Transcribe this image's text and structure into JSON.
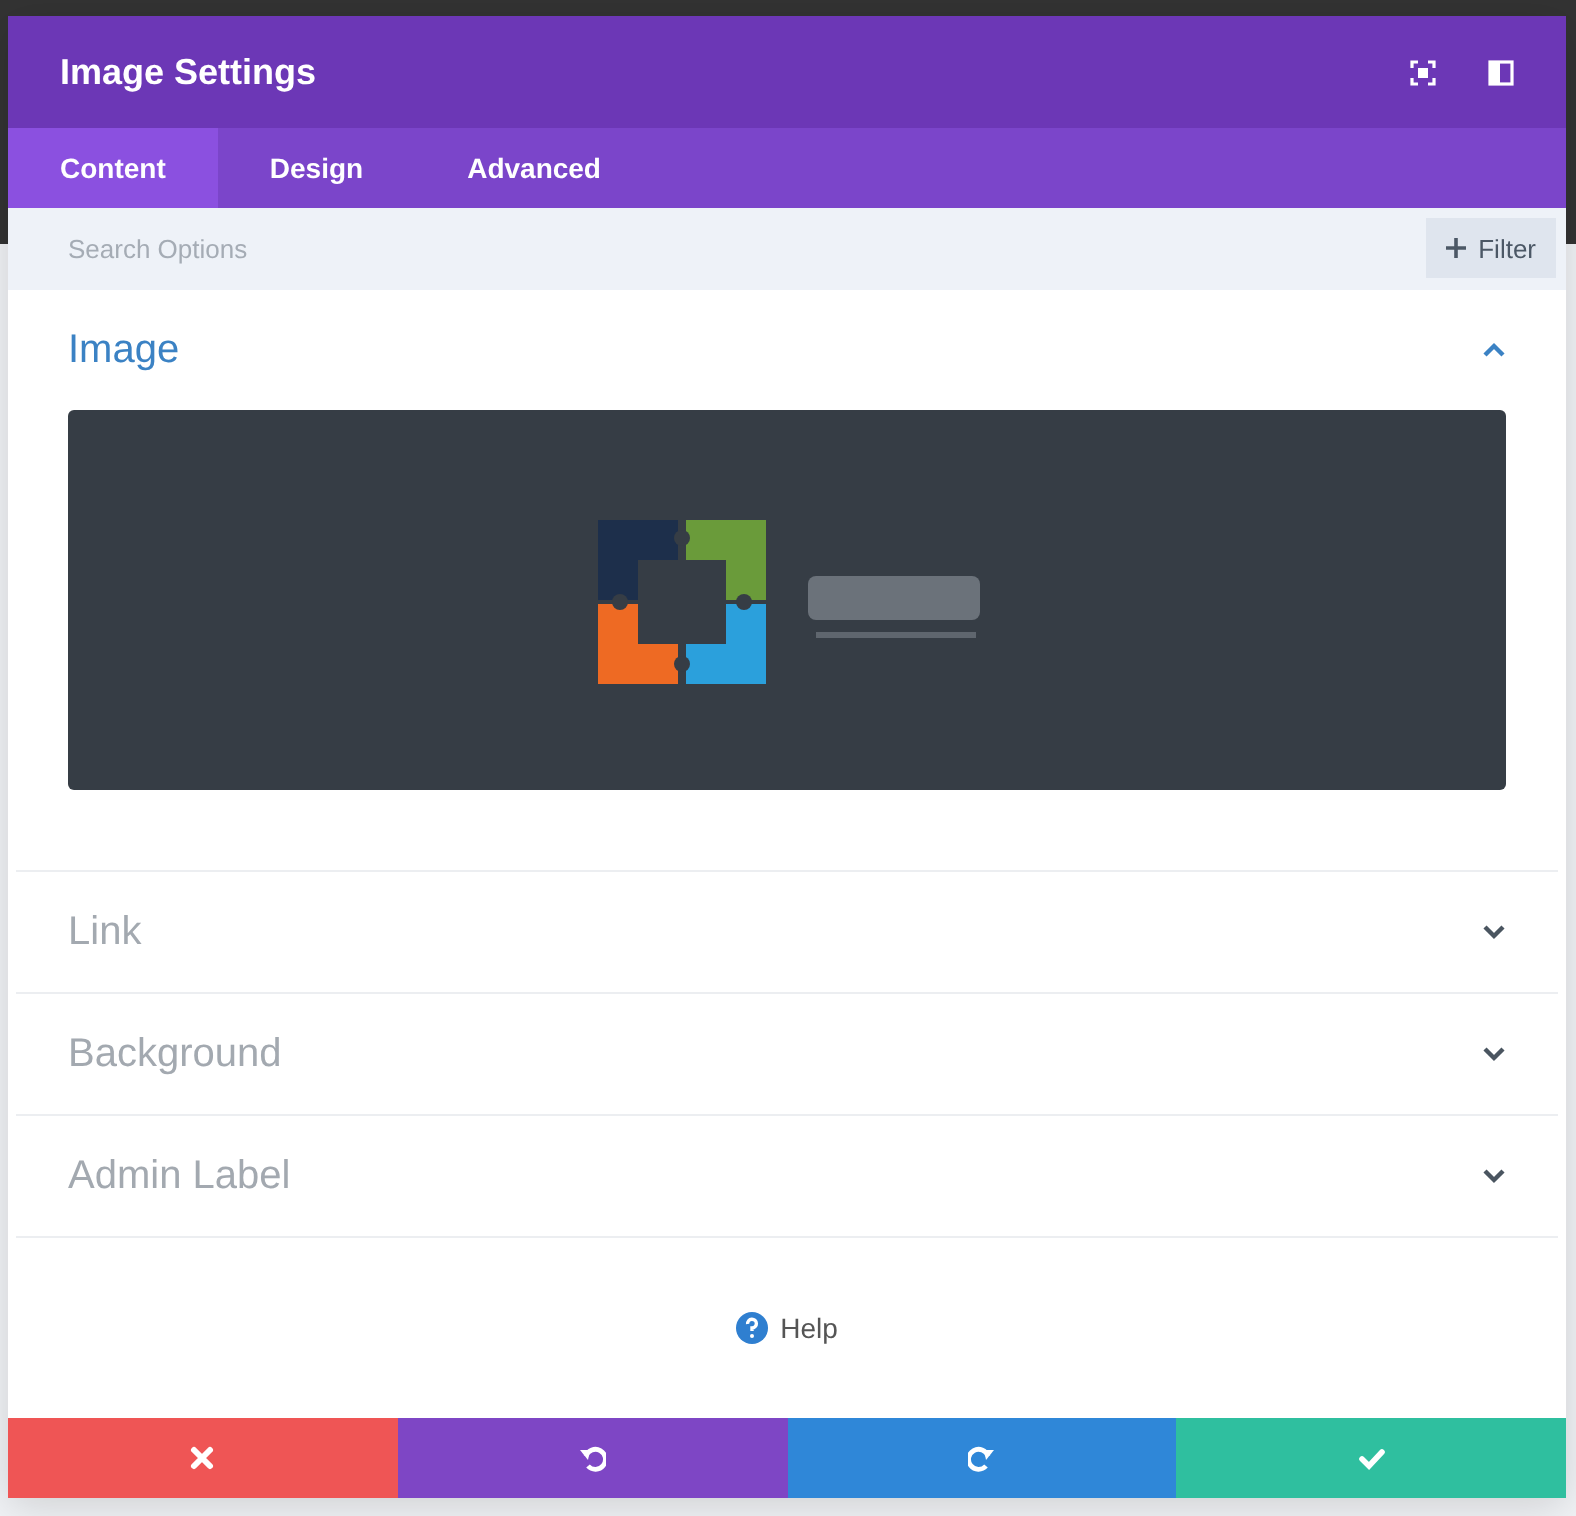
{
  "window": {
    "title": "Image Settings"
  },
  "tabs": [
    {
      "label": "Content",
      "selected": true
    },
    {
      "label": "Design",
      "selected": false
    },
    {
      "label": "Advanced",
      "selected": false
    }
  ],
  "search": {
    "placeholder": "Search Options"
  },
  "filter_button": {
    "label": "Filter"
  },
  "sections": [
    {
      "title": "Image",
      "expanded": true
    },
    {
      "title": "Link",
      "expanded": false
    },
    {
      "title": "Background",
      "expanded": false
    },
    {
      "title": "Admin Label",
      "expanded": false
    }
  ],
  "help": {
    "label": "Help"
  },
  "actions": [
    {
      "kind": "discard"
    },
    {
      "kind": "undo"
    },
    {
      "kind": "redo"
    },
    {
      "kind": "save"
    }
  ]
}
